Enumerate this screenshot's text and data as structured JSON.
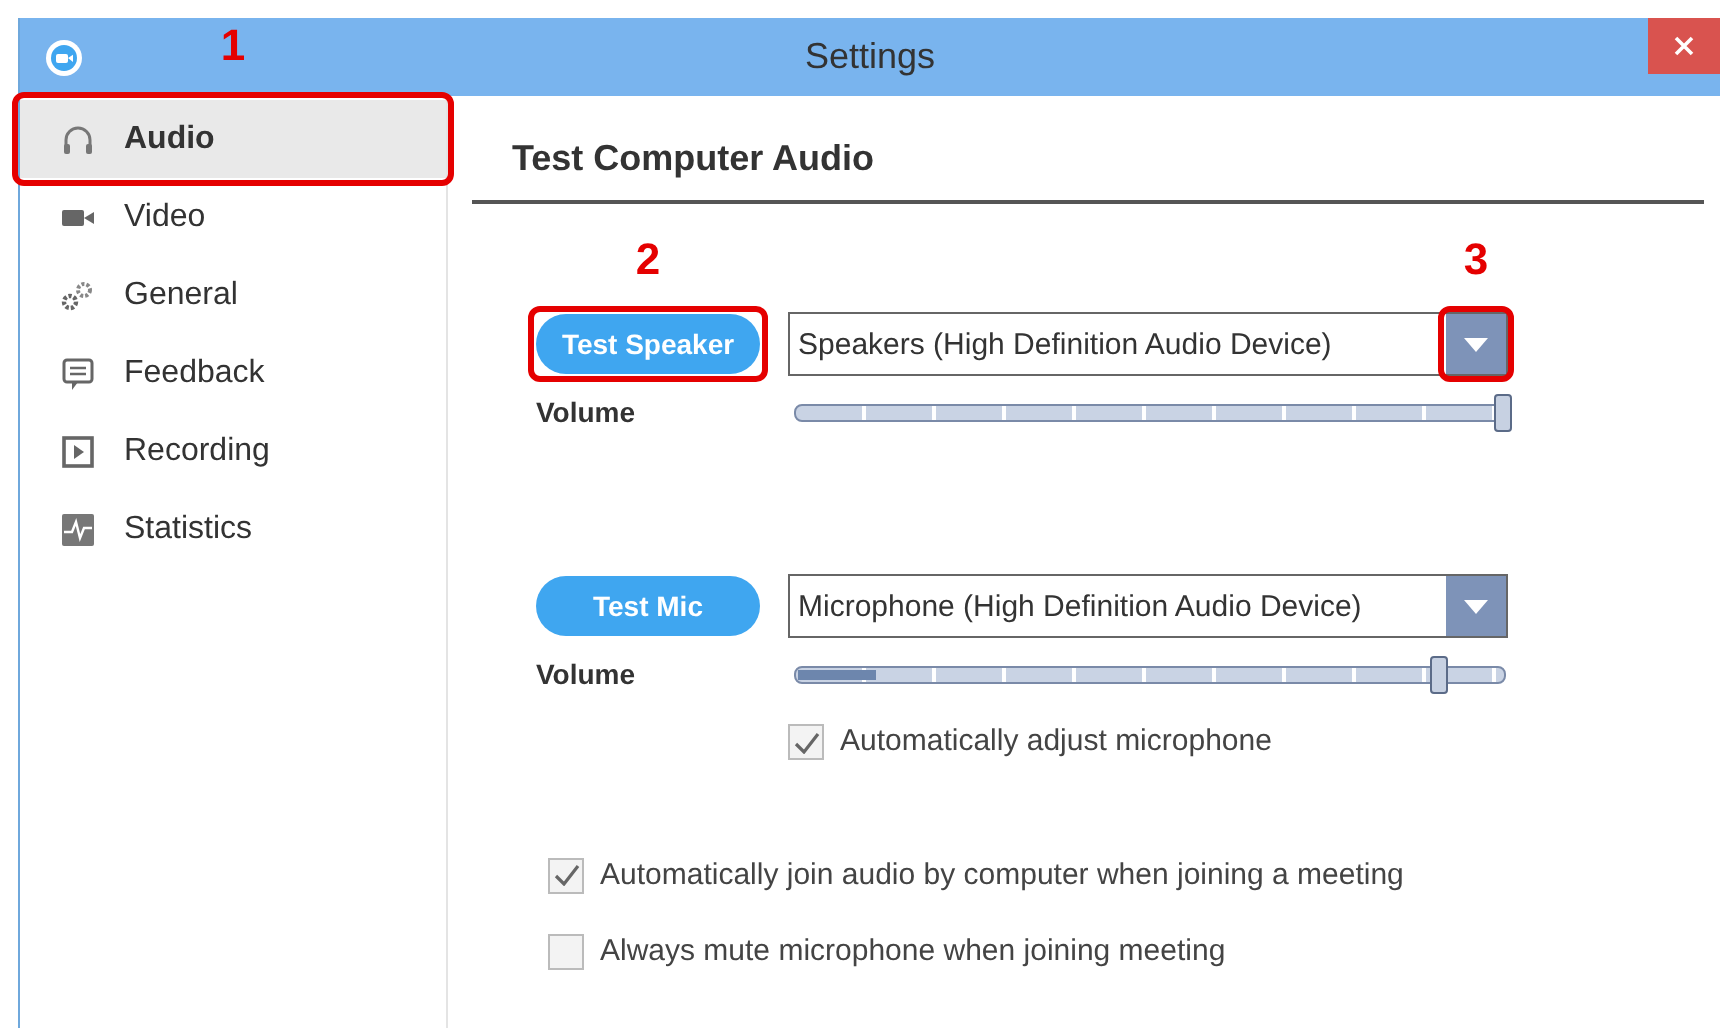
{
  "window": {
    "title": "Settings"
  },
  "sidebar": {
    "items": [
      {
        "label": "Audio",
        "selected": true,
        "annotation": "1"
      },
      {
        "label": "Video",
        "selected": false
      },
      {
        "label": "General",
        "selected": false
      },
      {
        "label": "Feedback",
        "selected": false
      },
      {
        "label": "Recording",
        "selected": false
      },
      {
        "label": "Statistics",
        "selected": false
      }
    ]
  },
  "main": {
    "heading": "Test Computer Audio",
    "speaker": {
      "button": "Test Speaker",
      "button_annotation": "2",
      "device": "Speakers (High Definition Audio Device)",
      "caret_annotation": "3",
      "volume_label": "Volume",
      "volume": {
        "level": 1.0
      }
    },
    "microphone": {
      "button": "Test Mic",
      "device": "Microphone (High Definition Audio Device)",
      "volume_label": "Volume",
      "volume": {
        "level": 0.91
      },
      "input_meter": {
        "level": 0.11
      },
      "auto_adjust": {
        "label": "Automatically adjust microphone",
        "checked": true
      }
    },
    "options": [
      {
        "label": "Automatically join audio by computer when joining a meeting",
        "checked": true
      },
      {
        "label": "Always mute microphone when joining meeting",
        "checked": false
      }
    ]
  }
}
